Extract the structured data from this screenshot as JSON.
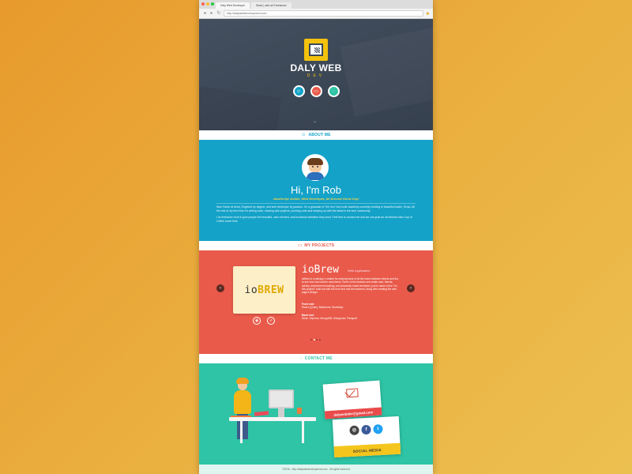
{
  "browser": {
    "tabs": [
      "Daly Web Developer",
      "Slack | web.all Freelancer"
    ],
    "address": "http://dalywebdevelopment.com",
    "dot_colors": [
      "#ff5f56",
      "#ffbd2e",
      "#27c93f"
    ]
  },
  "hero": {
    "brand_main": "DALY WEB",
    "brand_sub": "DEV",
    "icons": [
      "user-icon",
      "folder-icon",
      "chat-icon"
    ],
    "icon_colors": [
      "#14a2c8",
      "#e95a4a",
      "#2ec4a5"
    ]
  },
  "about": {
    "section_label": "ABOUT ME",
    "greeting": "Hi, I'm Rob",
    "role": "JavaScript Junkie, Web Developer, All Around Good Guy!",
    "bio": [
      "New Yorker at heart, Engineer by degree, and web developer by passion. I'm a graduate of The Iron Yard code academy currently residing in beautiful Austin, Texas. All the rest of my free time I'm writing code, chasing side projects, pushing code and keeping up with the latest in the tech community.",
      "I do freelance work to give people the beautiful, user oriented, and functional websites they need. Feel free to contact me and we can grab an old fashion Mac Cup of Coffee some time."
    ],
    "color": "#14a2c8"
  },
  "projects": {
    "section_label": "MY PROJECTS",
    "title": "ioBrew",
    "type": "Web Application",
    "logo_main": "io",
    "logo_accent": "BREW",
    "description": "ioBrew is a webapp I created for keeping track of all the beers between friends and fun, to see who has had the most beers. Some of the features are create user, friends, activity, achievement tracking, and automatic email reminders, just to name a few. For this project I built out both the front end and the backend, along with creating the web page's design.",
    "front_label": "Front end:",
    "front_stack": "React, jQuery, Backbone, Bootstrap",
    "back_label": "Back end:",
    "back_stack": "Node, Express, MongoDB, Mongoose, Passport",
    "prev_symbol": "‹",
    "next_symbol": "›",
    "dots": 4,
    "active_dot": 1,
    "color": "#e95a4a"
  },
  "contact": {
    "section_label": "CONTACT ME",
    "email": "dalywebdev@gmail.com",
    "social_label": "SOCIAL MEDIA",
    "social_icons": [
      "github-icon",
      "facebook-icon",
      "twitter-icon"
    ],
    "color": "#2ec4a5"
  },
  "footer": {
    "text": "©2016 - http://dalywebdevelopment.com · All rights reserved"
  }
}
